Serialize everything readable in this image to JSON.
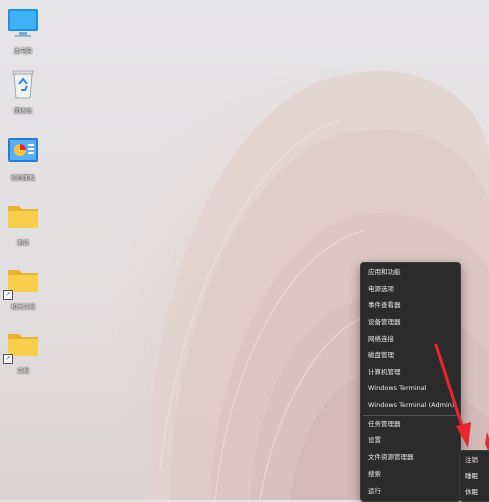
{
  "desktop": {
    "icons": [
      {
        "label": "此电脑",
        "icon": "monitor-icon"
      },
      {
        "label": "回收站",
        "icon": "recycle-bin-icon"
      },
      {
        "label": "控制面板",
        "icon": "control-panel-icon"
      },
      {
        "label": "测试",
        "icon": "folder-icon"
      },
      {
        "label": "相关文档",
        "icon": "folder-shortcut-icon"
      },
      {
        "label": "文档",
        "icon": "folder-shortcut-icon"
      }
    ]
  },
  "context_menu": {
    "items": [
      "应用和功能",
      "电源选项",
      "事件查看器",
      "设备管理器",
      "网络连接",
      "磁盘管理",
      "计算机管理",
      "Windows Terminal",
      "Windows Terminal (Admin)",
      "任务管理器",
      "设置",
      "文件资源管理器",
      "搜索",
      "运行"
    ]
  },
  "shutdown_submenu": {
    "items": [
      "注销",
      "睡眠",
      "休眠"
    ]
  },
  "colors": {
    "menu_bg": "#2b2b2b",
    "menu_text": "#e8e8e8",
    "arrow": "#e8262d",
    "folder": "#f4c542"
  }
}
